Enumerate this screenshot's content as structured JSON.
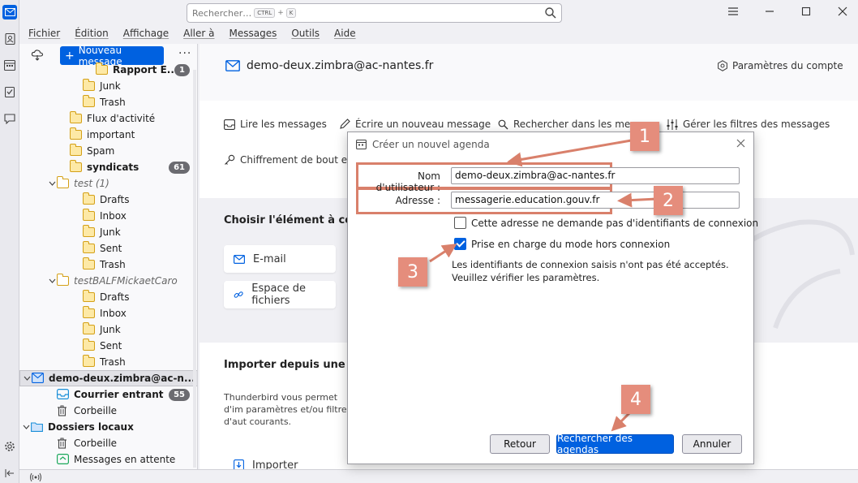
{
  "search": {
    "placeholder": "Rechercher…",
    "key1": "CTRL",
    "plus": "+",
    "key2": "K"
  },
  "menu": [
    "Fichier",
    "Édition",
    "Affichage",
    "Aller à",
    "Messages",
    "Outils",
    "Aide"
  ],
  "folder_pane": {
    "new_message": "Nouveau message",
    "more": "···",
    "items": [
      {
        "label": "Rapport E...",
        "indent": 5,
        "bold": true,
        "badge": "1",
        "type": "folder"
      },
      {
        "label": "Junk",
        "indent": 4,
        "type": "folder"
      },
      {
        "label": "Trash",
        "indent": 4,
        "type": "folder"
      },
      {
        "label": "Flux d'activité",
        "indent": 3,
        "type": "folder"
      },
      {
        "label": "important",
        "indent": 3,
        "type": "folder"
      },
      {
        "label": "Spam",
        "indent": 3,
        "type": "folder"
      },
      {
        "label": "syndicats",
        "indent": 3,
        "bold": true,
        "badge": "61",
        "type": "folder"
      },
      {
        "label": "test (1)",
        "indent": 2,
        "italic": true,
        "chevron": true,
        "plain": true,
        "type": "folder"
      },
      {
        "label": "Drafts",
        "indent": 4,
        "type": "folder"
      },
      {
        "label": "Inbox",
        "indent": 4,
        "type": "folder"
      },
      {
        "label": "Junk",
        "indent": 4,
        "type": "folder"
      },
      {
        "label": "Sent",
        "indent": 4,
        "type": "folder"
      },
      {
        "label": "Trash",
        "indent": 4,
        "type": "folder"
      },
      {
        "label": "testBALFMickaetCaro",
        "indent": 2,
        "italic": true,
        "chevron": true,
        "plain": true,
        "type": "folder"
      },
      {
        "label": "Drafts",
        "indent": 4,
        "type": "folder"
      },
      {
        "label": "Inbox",
        "indent": 4,
        "type": "folder"
      },
      {
        "label": "Junk",
        "indent": 4,
        "type": "folder"
      },
      {
        "label": "Sent",
        "indent": 4,
        "type": "folder"
      },
      {
        "label": "Trash",
        "indent": 4,
        "type": "folder"
      },
      {
        "label": "demo-deux.zimbra@ac-n...",
        "indent": 0,
        "bold": true,
        "chevron": true,
        "selected": true,
        "type": "account"
      },
      {
        "label": "Courrier entrant",
        "indent": 2,
        "bold": true,
        "badge": "55",
        "type": "inbox"
      },
      {
        "label": "Corbeille",
        "indent": 2,
        "type": "trash"
      },
      {
        "label": "Dossiers locaux",
        "indent": 0,
        "bold": true,
        "chevron": true,
        "type": "localfolder"
      },
      {
        "label": "Corbeille",
        "indent": 2,
        "type": "trash"
      },
      {
        "label": "Messages en attente",
        "indent": 2,
        "type": "outbox"
      }
    ]
  },
  "account": {
    "email": "demo-deux.zimbra@ac-nantes.fr",
    "settings": "Paramètres du compte",
    "actions": [
      "Lire les messages",
      "Écrire un nouveau message",
      "Rechercher dans les message",
      "Gérer les filtres des messages",
      "Chiffrement de bout en b"
    ],
    "choose_title": "Choisir l'élément à confi",
    "cards": [
      "E-mail",
      "Espace de fichiers"
    ],
    "import_title": "Importer depuis une autre",
    "import_text": "Thunderbird vous permet d'im paramètres et/ou filtres d'aut courants.",
    "import_button": "Importer"
  },
  "dialog": {
    "title": "Créer un nouvel agenda",
    "username_label": "Nom d'utilisateur :",
    "username_value": "demo-deux.zimbra@ac-nantes.fr",
    "address_label": "Adresse :",
    "address_value": "messagerie.education.gouv.fr",
    "no_credentials_label": "Cette adresse ne demande pas d'identifiants de connexion",
    "no_credentials_checked": false,
    "offline_label": "Prise en charge du mode hors connexion",
    "offline_checked": true,
    "error_message": "Les identifiants de connexion saisis n'ont pas été acceptés. Veuillez vérifier les paramètres.",
    "btn_back": "Retour",
    "btn_search": "Rechercher des agendas",
    "btn_cancel": "Annuler"
  },
  "callouts": [
    "1",
    "2",
    "3",
    "4"
  ],
  "colors": {
    "accent": "#0061e0",
    "callout": "#e58d7c",
    "highlight": "#d9806b",
    "folder": "#d4a017"
  }
}
